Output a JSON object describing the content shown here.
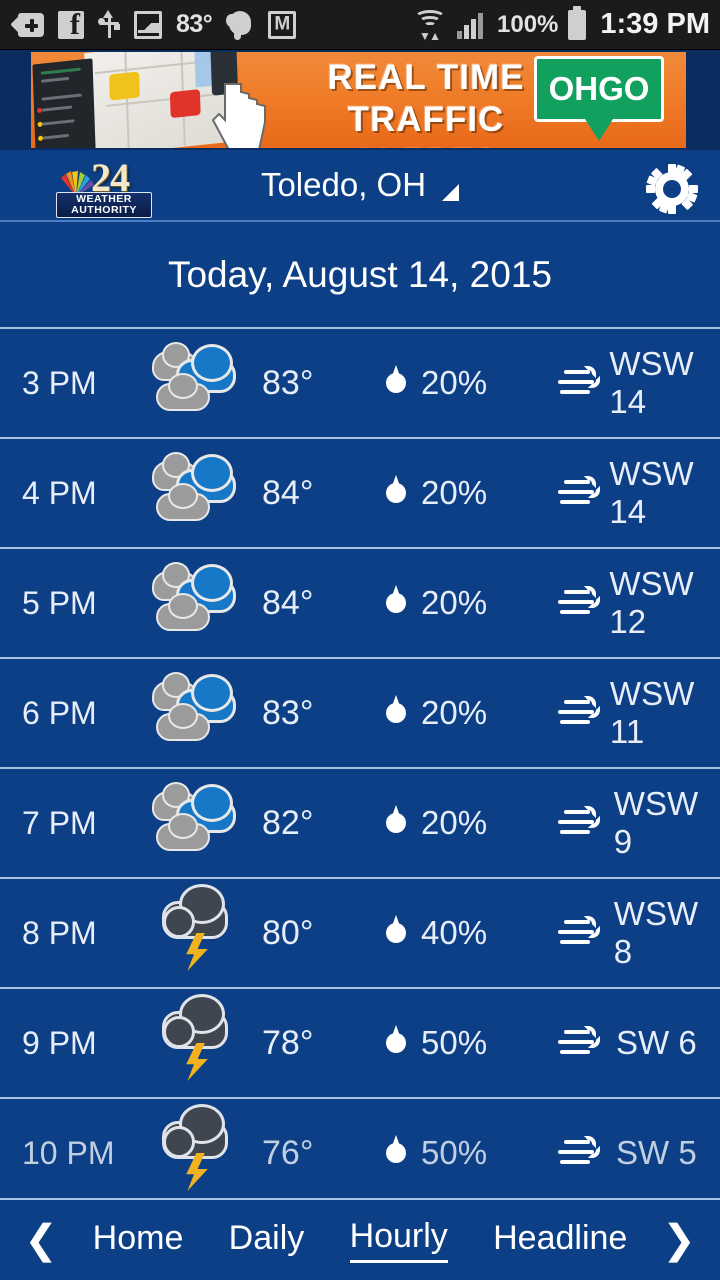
{
  "status_bar": {
    "icons": [
      "back-add-icon",
      "facebook-icon",
      "usb-icon",
      "photo-icon"
    ],
    "temperature": "83°",
    "app_icons": [
      "evernote-icon",
      "gmail-icon"
    ],
    "wifi_icon": "wifi-icon",
    "signal_icon": "cellular-signal-icon",
    "battery_percent": "100%",
    "battery_icon": "battery-icon",
    "time": "1:39 PM"
  },
  "ad": {
    "line1": "REAL TIME",
    "line2": "TRAFFIC ALERTS",
    "logo": "OHGO",
    "logo_color": "#12a05e",
    "bg_color": "#ef7c28"
  },
  "header": {
    "logo": {
      "number": "24",
      "band_line1": "WEATHER",
      "band_line2": "AUTHORITY",
      "peacock": "nbc-peacock-icon"
    },
    "city": "Toledo, OH",
    "caret": "dropdown-caret-icon",
    "settings_icon": "gear-icon"
  },
  "date_header": "Today, August 14, 2015",
  "theme": {
    "background": "#0d3f87",
    "divider": "#a9c2e2",
    "text": "#ffffff",
    "cloud_blue": "#1878c8",
    "cloud_gray": "#9b9b9b",
    "storm_cloud": "#3f4650",
    "bolt": "#f0b21e"
  },
  "hourly": [
    {
      "time": "3 PM",
      "condition": "partly-cloudy",
      "temp": "83°",
      "pop": "20%",
      "wind": "WSW 14"
    },
    {
      "time": "4 PM",
      "condition": "partly-cloudy",
      "temp": "84°",
      "pop": "20%",
      "wind": "WSW 14"
    },
    {
      "time": "5 PM",
      "condition": "partly-cloudy",
      "temp": "84°",
      "pop": "20%",
      "wind": "WSW 12"
    },
    {
      "time": "6 PM",
      "condition": "partly-cloudy",
      "temp": "83°",
      "pop": "20%",
      "wind": "WSW 11"
    },
    {
      "time": "7 PM",
      "condition": "partly-cloudy",
      "temp": "82°",
      "pop": "20%",
      "wind": "WSW 9"
    },
    {
      "time": "8 PM",
      "condition": "thunderstorm",
      "temp": "80°",
      "pop": "40%",
      "wind": "WSW 8"
    },
    {
      "time": "9 PM",
      "condition": "thunderstorm",
      "temp": "78°",
      "pop": "50%",
      "wind": "SW 6"
    },
    {
      "time": "10 PM",
      "condition": "thunderstorm",
      "temp": "76°",
      "pop": "50%",
      "wind": "SW 5"
    }
  ],
  "bottom_nav": {
    "prev_icon": "chevron-left-icon",
    "next_icon": "chevron-right-icon",
    "items": [
      {
        "label": "Home",
        "active": false
      },
      {
        "label": "Daily",
        "active": false
      },
      {
        "label": "Hourly",
        "active": true
      },
      {
        "label": "Headline",
        "active": false
      }
    ]
  }
}
